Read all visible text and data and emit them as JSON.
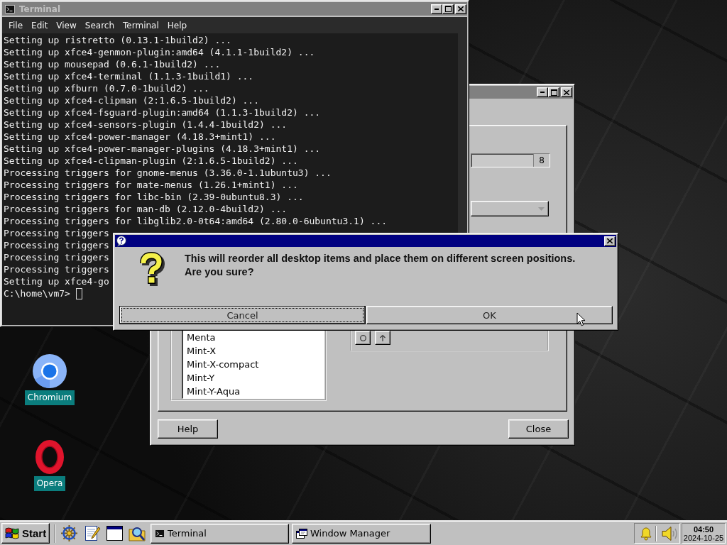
{
  "desktop_icons": [
    {
      "label": "Chromium",
      "kind": "ring"
    },
    {
      "label": "Opera",
      "kind": "oval"
    }
  ],
  "terminal": {
    "title": "Terminal",
    "active": false,
    "menu": [
      "File",
      "Edit",
      "View",
      "Search",
      "Terminal",
      "Help"
    ],
    "lines": [
      "Setting up ristretto (0.13.1-1build2) ...",
      "Setting up xfce4-genmon-plugin:amd64 (4.1.1-1build2) ...",
      "Setting up mousepad (0.6.1-1build2) ...",
      "Setting up xfce4-terminal (1.1.3-1build1) ...",
      "Setting up xfburn (0.7.0-1build2) ...",
      "Setting up xfce4-clipman (2:1.6.5-1build2) ...",
      "Setting up xfce4-fsguard-plugin:amd64 (1.1.3-1build2) ...",
      "Setting up xfce4-sensors-plugin (1.4.4-1build2) ...",
      "Setting up xfce4-power-manager (4.18.3+mint1) ...",
      "Setting up xfce4-power-manager-plugins (4.18.3+mint1) ...",
      "Setting up xfce4-clipman-plugin (2:1.6.5-1build2) ...",
      "Processing triggers for gnome-menus (3.36.0-1.1ubuntu3) ...",
      "Processing triggers for mate-menus (1.26.1+mint1) ...",
      "Processing triggers for libc-bin (2.39-0ubuntu8.3) ...",
      "Processing triggers for man-db (2.12.0-4build2) ...",
      "Processing triggers for libglib2.0-0t64:amd64 (2.80.0-6ubuntu3.1) ...",
      "Processing triggers",
      "Processing triggers",
      "Processing triggers",
      "Processing triggers",
      "Setting up xfce4-go"
    ],
    "prompt": "C:\\home\\vm7>"
  },
  "window_manager": {
    "active": false,
    "number_field": "8",
    "list_items": [
      {
        "label": "Menta",
        "selected": false
      },
      {
        "label": "Mint-X",
        "selected": false
      },
      {
        "label": "Mint-X-compact",
        "selected": false
      },
      {
        "label": "Mint-Y",
        "selected": false
      },
      {
        "label": "Mint-Y-Aqua",
        "selected": false
      }
    ],
    "buttons": [
      "Help",
      "Close"
    ]
  },
  "dialog": {
    "active": true,
    "message_lines": [
      "This will reorder all desktop items and place them on different screen positions.",
      "Are you sure?"
    ],
    "buttons": [
      {
        "label": "Cancel",
        "focused": true
      },
      {
        "label": "OK",
        "focused": false
      }
    ]
  },
  "taskbar": {
    "start": "Start",
    "tasks": [
      {
        "label": "Terminal",
        "kind": "terminal",
        "selected": false
      },
      {
        "label": "Window Manager",
        "kind": "window",
        "selected": false
      }
    ],
    "clock": {
      "time": "04:50",
      "date": "2024-10-25"
    }
  }
}
